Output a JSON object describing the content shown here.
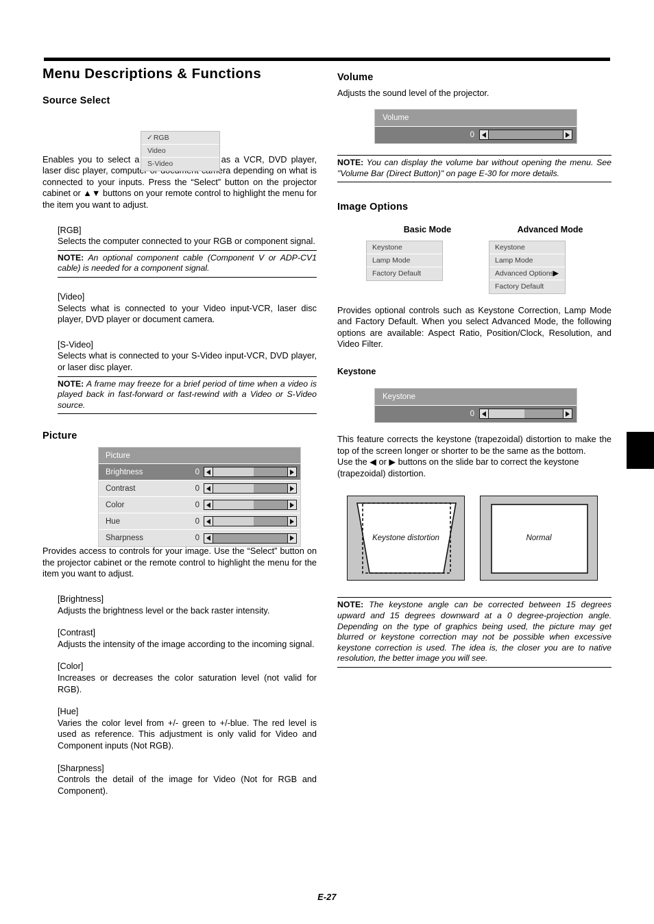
{
  "page": {
    "title": "Menu Descriptions & Functions",
    "footer": "E-27"
  },
  "left_column": {
    "source_select": {
      "heading": "Source Select",
      "menu": {
        "items": [
          {
            "label": "RGB",
            "check": "✓",
            "checked": true
          },
          {
            "label": "Video",
            "check": "",
            "checked": false
          },
          {
            "label": "S-Video",
            "check": "",
            "checked": false
          }
        ]
      },
      "intro": "Enables you to select a video source such as a VCR, DVD player, laser disc player, computer or document camera depending on what is connected to your inputs. Press the “Select” button on the projector cabinet or ▲▼ buttons on your remote control to highlight the menu for the item you want to adjust.",
      "entries": [
        {
          "term": "[RGB]",
          "text": "Selects the computer connected to your RGB or component signal.",
          "note_label": "NOTE:",
          "note": " An optional component cable (Component V or ADP-CV1 cable) is needed for a component signal."
        },
        {
          "term": "[Video]",
          "text": "Selects what is connected to your Video input-VCR, laser disc player, DVD player or document camera.",
          "note_label": "",
          "note": ""
        },
        {
          "term": "[S-Video]",
          "text": "Selects what is connected to your S-Video input-VCR, DVD player, or laser disc player.",
          "note_label": "NOTE:",
          "note": " A frame may freeze for a brief period of time when a video is played back in fast-forward or fast-rewind with a Video or S-Video source."
        }
      ]
    },
    "picture": {
      "heading": "Picture",
      "panel": {
        "header": "Picture",
        "rows": [
          {
            "label": "Brightness",
            "value": "0",
            "fill": 55,
            "selected": true
          },
          {
            "label": "Contrast",
            "value": "0",
            "fill": 55,
            "selected": false
          },
          {
            "label": "Color",
            "value": "0",
            "fill": 55,
            "selected": false
          },
          {
            "label": "Hue",
            "value": "0",
            "fill": 55,
            "selected": false
          },
          {
            "label": "Sharpness",
            "value": "0",
            "fill": 0,
            "selected": false
          }
        ]
      },
      "intro": "Provides access to controls for your image. Use the “Select” button on the projector cabinet or the remote control to highlight the menu for the item you want to adjust.",
      "entries": [
        {
          "term": "[Brightness]",
          "text": "Adjusts the brightness level or the back raster intensity."
        },
        {
          "term": "[Contrast]",
          "text": "Adjusts the intensity of the image according to the incoming signal."
        },
        {
          "term": "[Color]",
          "text": "Increases or decreases the color saturation level (not valid for RGB)."
        },
        {
          "term": "[Hue]",
          "text": "Varies the color level from +/- green to +/-blue. The red level is used as reference. This adjustment is only valid for Video and Component inputs (Not RGB)."
        },
        {
          "term": "[Sharpness]",
          "text": "Controls the detail of the image for Video (Not for RGB and Component)."
        }
      ]
    }
  },
  "right_column": {
    "volume": {
      "heading": "Volume",
      "intro": "Adjusts the sound level of the projector.",
      "widget": {
        "header": "Volume",
        "value": "0",
        "fill": 0
      },
      "note_label": "NOTE:",
      "note": " You can display the volume bar without opening the menu. See \"Volume Bar (Direct Button)\" on page E-30 for more details."
    },
    "image_options": {
      "heading": "Image Options",
      "basic_mode": {
        "title": "Basic Mode",
        "items": [
          {
            "label": "Keystone",
            "arrow": ""
          },
          {
            "label": "Lamp Mode",
            "arrow": ""
          },
          {
            "label": "Factory Default",
            "arrow": ""
          }
        ]
      },
      "advanced_mode": {
        "title": "Advanced Mode",
        "items": [
          {
            "label": "Keystone",
            "arrow": ""
          },
          {
            "label": "Lamp Mode",
            "arrow": ""
          },
          {
            "label": "Advanced Options",
            "arrow": "▶"
          },
          {
            "label": "Factory Default",
            "arrow": ""
          }
        ]
      },
      "body": "Provides optional controls such as Keystone Correction, Lamp Mode and Factory Default. When you select Advanced Mode, the following options are available: Aspect Ratio, Position/Clock, Resolution, and Video Filter."
    },
    "keystone": {
      "heading": "Keystone",
      "widget": {
        "header": "Keystone",
        "value": "0",
        "fill": 48
      },
      "body1": "This feature corrects the keystone (trapezoidal) distortion to make the top of the screen longer or shorter to be the same as the bottom.",
      "body2": "Use the ◀ or ▶ buttons on the slide bar to correct the keystone (trapezoidal) distortion.",
      "figures": [
        {
          "caption": "Keystone distortion",
          "type": "trapezoid"
        },
        {
          "caption": "Normal",
          "type": "rectangle"
        }
      ],
      "note_label": "NOTE:",
      "note": " The keystone angle can be corrected between 15 degrees upward and 15 degrees downward at a 0 degree-projection angle. Depending on the type of graphics being used, the picture may get blurred or keystone correction may not be possible when excessive keystone correction is used. The idea is, the closer you are to native resolution, the better image you will see."
    }
  },
  "colors": {
    "osd_header": "#9b9b9b",
    "osd_row": "#e3e3e3",
    "osd_row_selected": "#838383",
    "bar_body": "#7e7e7e",
    "slider_track": "#a0a0a0",
    "slider_fill": "#d2d2d2",
    "figure_bg": "#c6c6c6"
  }
}
